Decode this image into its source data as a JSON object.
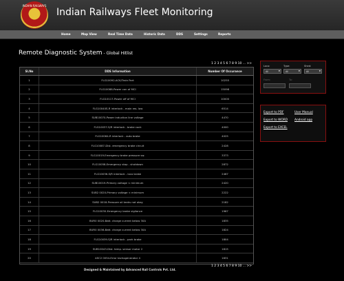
{
  "header": {
    "title": "Indian Railways Fleet Monitoring",
    "logo_text": "INDIAN RAILWAYS"
  },
  "nav": [
    "Home",
    "Map View",
    "Real Time Data",
    "Historic Data",
    "DDS",
    "Settings",
    "Reports"
  ],
  "page": {
    "title": "Remote Diagnostic System",
    "subtitle": " - Global Hitlist"
  },
  "pagination": {
    "text": "1 2 3 4 5 6 7 8 9 10 ... >>"
  },
  "table": {
    "headers": [
      "Sl.No",
      "DDS Information",
      "Number Of Occurance"
    ],
    "rows": [
      [
        "1",
        "FLG10092-ACK/Train Part",
        "10255"
      ],
      [
        "2",
        "FLG10088-Power con of MCI",
        "15098"
      ],
      [
        "3",
        "FLG10117-Power off of MCI",
        "10000"
      ],
      [
        "4",
        "FLG10040S-R interlock - main res. low",
        "6514"
      ],
      [
        "5",
        "SUB10070-Power induction line voltage",
        "4470"
      ],
      [
        "6",
        "FLG10037-S/R interlock - brake cock",
        "4000"
      ],
      [
        "7",
        "FLG10064-R interlock - auto brake",
        "4025"
      ],
      [
        "8",
        "FLG10087-Dist. emergency brake circuit",
        "2428"
      ],
      [
        "9",
        "FLG10019-Emergency brake pressure sw.",
        "3373"
      ],
      [
        "10",
        "FLG10058-Emergency stop - shutdown",
        "2872"
      ],
      [
        "11",
        "FLG10036-S/R interlock - loco brake",
        "2467"
      ],
      [
        "12",
        "SUB10019-Primary voltage < minimum",
        "2420"
      ],
      [
        "13",
        "SUB2 0020-Primary voltage < minimum",
        "2222"
      ],
      [
        "14",
        "SUB2 0018-Pressure oil tanks not okay",
        "2182"
      ],
      [
        "15",
        "FLG10030-Emergency brake vigilance",
        "1967"
      ],
      [
        "16",
        "BUR0 0020-Batt. charge current below 30A",
        "1835"
      ],
      [
        "17",
        "BUR0 0036-Batt. charge current below 30A",
        "1824"
      ],
      [
        "18",
        "FLG10039-S/R interlock - park brake",
        "1804"
      ],
      [
        "19",
        "SUB10043-Dist. temp. sensor motor 2",
        "1815"
      ],
      [
        "20",
        "ASC2 0054-Error tachogenerator 4",
        "1631"
      ]
    ]
  },
  "filters": {
    "loco_label": "Loco:",
    "loco_value": "All",
    "type_label": "Type:",
    "type_value": "All",
    "shed_label": "Shed:",
    "shed_value": "All",
    "from_label": "From:",
    "to_label": "To:"
  },
  "exports": {
    "pdf": "Export to PDF",
    "word": "Export to WORD",
    "excel": "Export to EXCEL",
    "manual": "User Manual",
    "android": "Android app"
  },
  "footer": "Designed & Maintained by Advanced Rail Controls Pvt. Ltd."
}
